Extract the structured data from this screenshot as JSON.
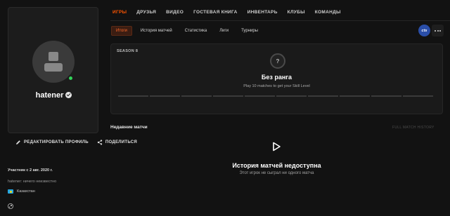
{
  "nav": {
    "main_tabs": [
      {
        "label": "ИГРЫ",
        "active": true
      },
      {
        "label": "ДРУЗЬЯ",
        "active": false
      },
      {
        "label": "ВИДЕО",
        "active": false
      },
      {
        "label": "ГОСТЕВАЯ КНИГА",
        "active": false
      },
      {
        "label": "ИНВЕНТАРЬ",
        "active": false
      },
      {
        "label": "КЛУБЫ",
        "active": false
      },
      {
        "label": "КОМАНДЫ",
        "active": false
      }
    ],
    "sub_tabs": [
      {
        "label": "Итоги",
        "active": true
      },
      {
        "label": "История матчей",
        "active": false
      },
      {
        "label": "Статистика",
        "active": false
      },
      {
        "label": "Лиги",
        "active": false
      },
      {
        "label": "Турниры",
        "active": false
      }
    ],
    "game_badge": "cts",
    "accent_color": "#ff5500"
  },
  "profile": {
    "nickname": "hatener",
    "online": true,
    "edit_label": "РЕДАКТИРОВАТЬ ПРОФИЛЬ",
    "share_label": "ПОДЕЛИТЬСЯ",
    "member_since": "Участник с 2 авг. 2020 г.",
    "bio": "hatener: ничего неизвестно",
    "country": "Казахстан"
  },
  "season": {
    "label": "SEASON 8",
    "rank_icon_text": "?",
    "rank_title": "Без ранга",
    "rank_subtitle": "Play 10 matches to get your Skill Level"
  },
  "recent": {
    "title": "Недавние матчи",
    "full_history": "FULL MATCH HISTORY",
    "empty_title": "История матчей недоступна",
    "empty_subtitle": "Этот игрок не сыграл ни одного матча"
  }
}
